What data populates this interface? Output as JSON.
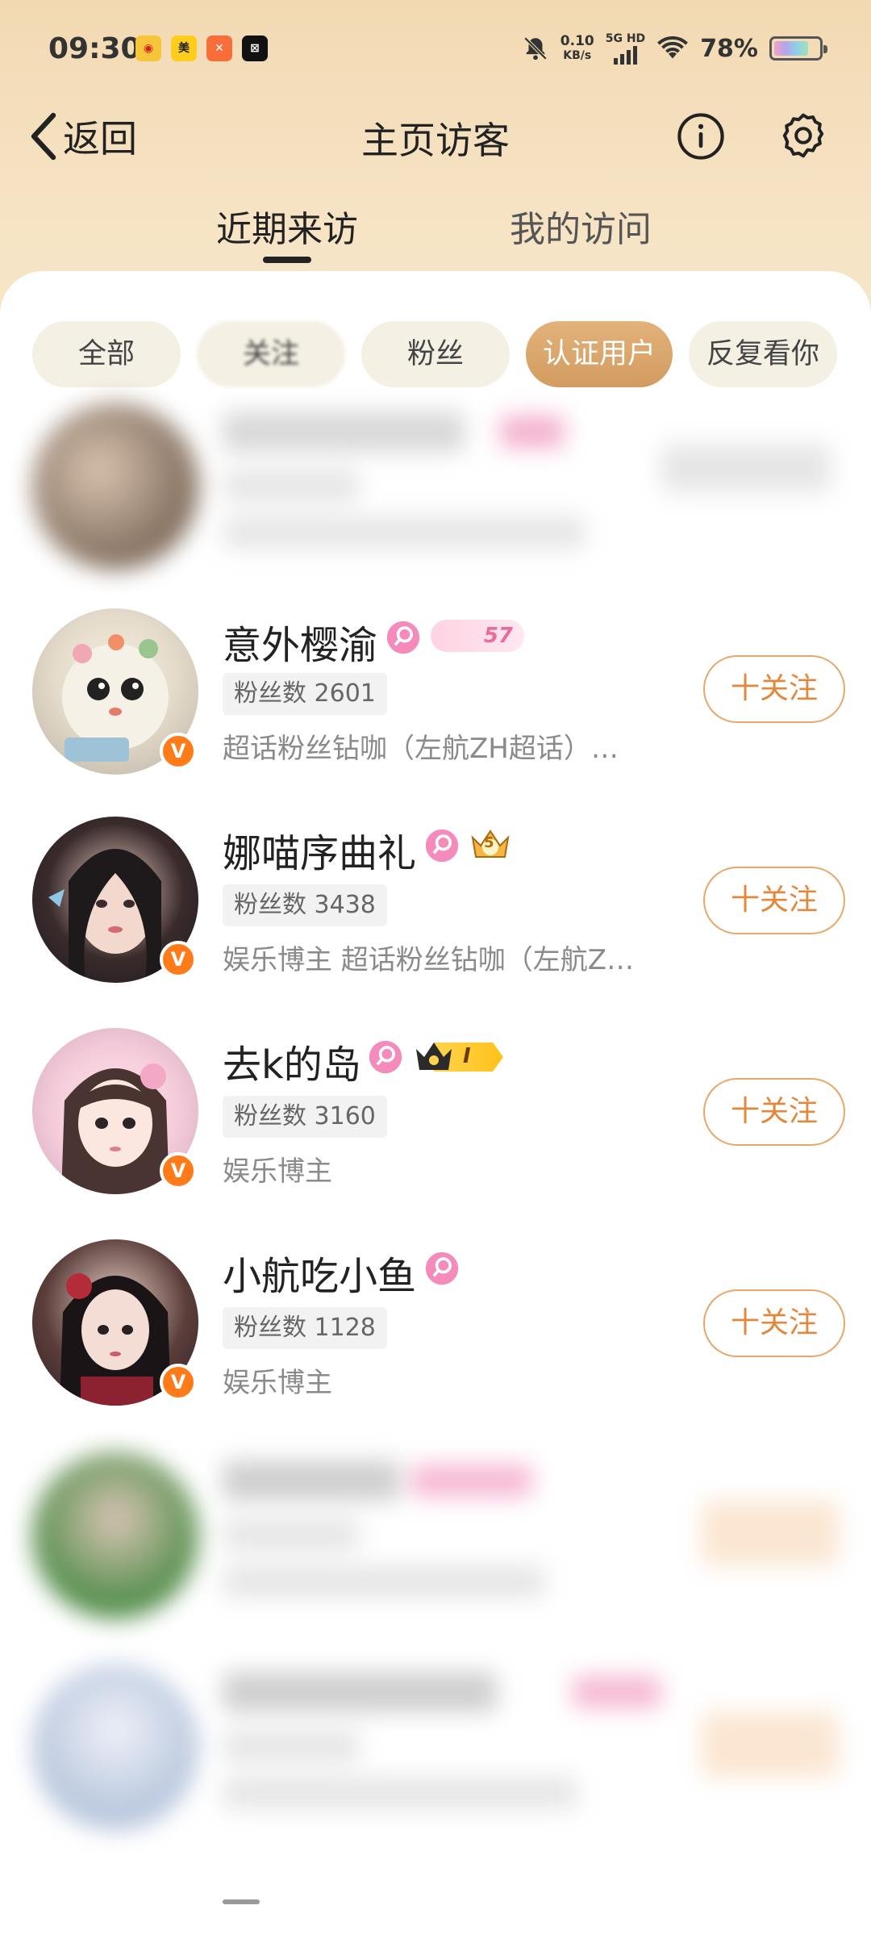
{
  "status_bar": {
    "time": "09:30",
    "net_speed": "0.10",
    "net_unit": "KB/s",
    "network": "5G HD",
    "battery_pct": "78%",
    "app_icons": [
      "weibo-icon",
      "meituan-icon",
      "app-icon",
      "capcut-icon"
    ]
  },
  "nav": {
    "back_label": "返回",
    "title": "主页访客"
  },
  "tabs": [
    {
      "label": "近期来访",
      "active": true
    },
    {
      "label": "我的访问",
      "active": false
    }
  ],
  "filters": [
    {
      "label": "全部"
    },
    {
      "label": "关注"
    },
    {
      "label": "粉丝"
    },
    {
      "label": "认证用户",
      "active": true
    },
    {
      "label": "反复看你"
    }
  ],
  "visitors": [
    {
      "name": "意外樱渝",
      "fans_text": "粉丝数 2601",
      "desc": "超话粉丝钻咖（左航ZH超话）…",
      "level_badge": "57",
      "follow_label": "十关注"
    },
    {
      "name": "娜喵序曲礼",
      "fans_text": "粉丝数 3438",
      "desc": "娱乐博主 超话粉丝钻咖（左航Z…",
      "level_badge": "5",
      "follow_label": "十关注"
    },
    {
      "name": "去k的岛",
      "fans_text": "粉丝数 3160",
      "desc": "娱乐博主",
      "level_badge": "I",
      "follow_label": "十关注"
    },
    {
      "name": "小航吃小鱼",
      "fans_text": "粉丝数 1128",
      "desc": "娱乐博主",
      "follow_label": "十关注"
    }
  ],
  "verified_badge": "V",
  "colors": {
    "accent": "#e3883a",
    "active_chip": "#d39c5f",
    "header_bg": "#f2d9b2",
    "verified": "#ff7b1a",
    "member_pink": "#f48bbb"
  }
}
